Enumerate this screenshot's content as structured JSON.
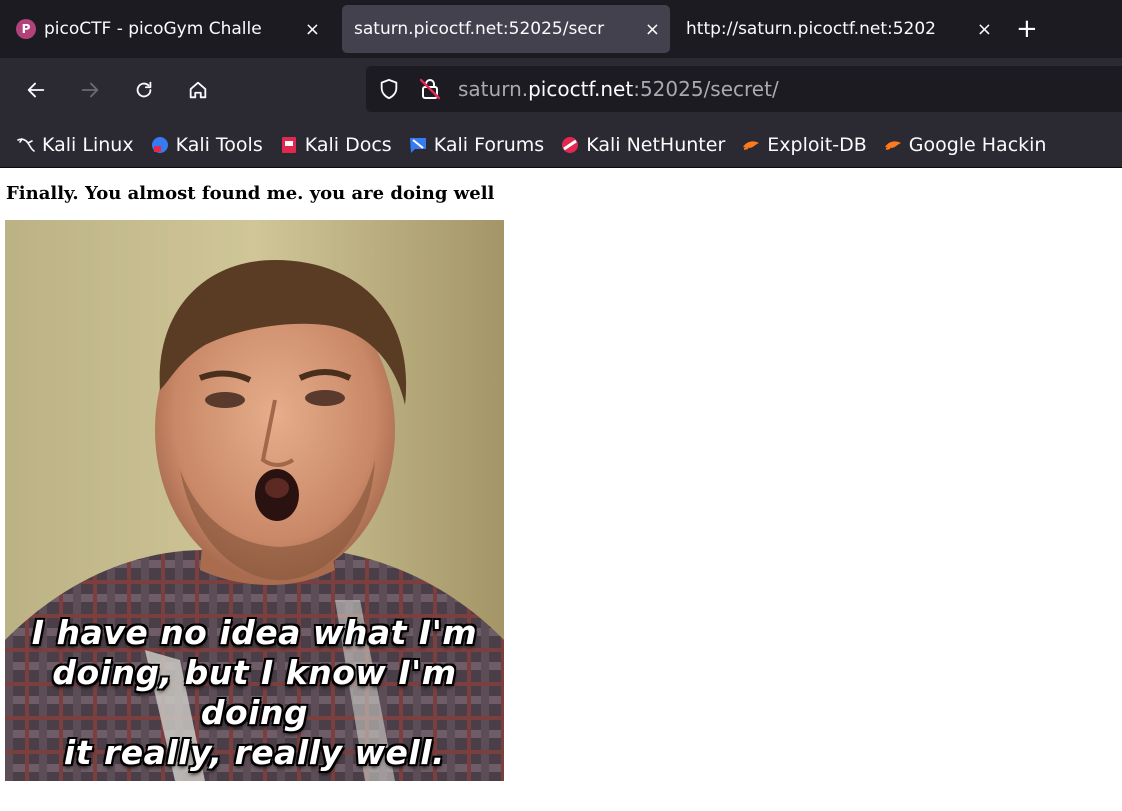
{
  "tabs": [
    {
      "title": "picoCTF - picoGym Challe",
      "favicon": "picoctf-icon",
      "active": false
    },
    {
      "title": "saturn.picoctf.net:52025/secr",
      "favicon": "",
      "active": true
    },
    {
      "title": "http://saturn.picoctf.net:5202",
      "favicon": "",
      "active": false
    }
  ],
  "tab_close_glyph": "×",
  "new_tab_glyph": "+",
  "url": {
    "prefix": "saturn.",
    "host": "picoctf.net",
    "suffix": ":52025/secret/"
  },
  "bookmarks": [
    {
      "label": "Kali Linux",
      "icon": "kali-linux-icon"
    },
    {
      "label": "Kali Tools",
      "icon": "kali-tools-icon"
    },
    {
      "label": "Kali Docs",
      "icon": "kali-docs-icon"
    },
    {
      "label": "Kali Forums",
      "icon": "kali-forums-icon"
    },
    {
      "label": "Kali NetHunter",
      "icon": "kali-nethunter-icon"
    },
    {
      "label": "Exploit-DB",
      "icon": "exploit-db-icon"
    },
    {
      "label": "Google Hackin",
      "icon": "google-hacking-icon"
    }
  ],
  "page": {
    "heading": "Finally. You almost found me. you are doing well",
    "meme_caption": "I have no idea what I'm\ndoing, but I know I'm doing\nit really, really well."
  },
  "colors": {
    "tabstrip_bg": "#1c1b22",
    "toolbar_bg": "#2b2a33",
    "active_tab_bg": "#42414d",
    "picoctf_favicon": "#b2427a"
  }
}
